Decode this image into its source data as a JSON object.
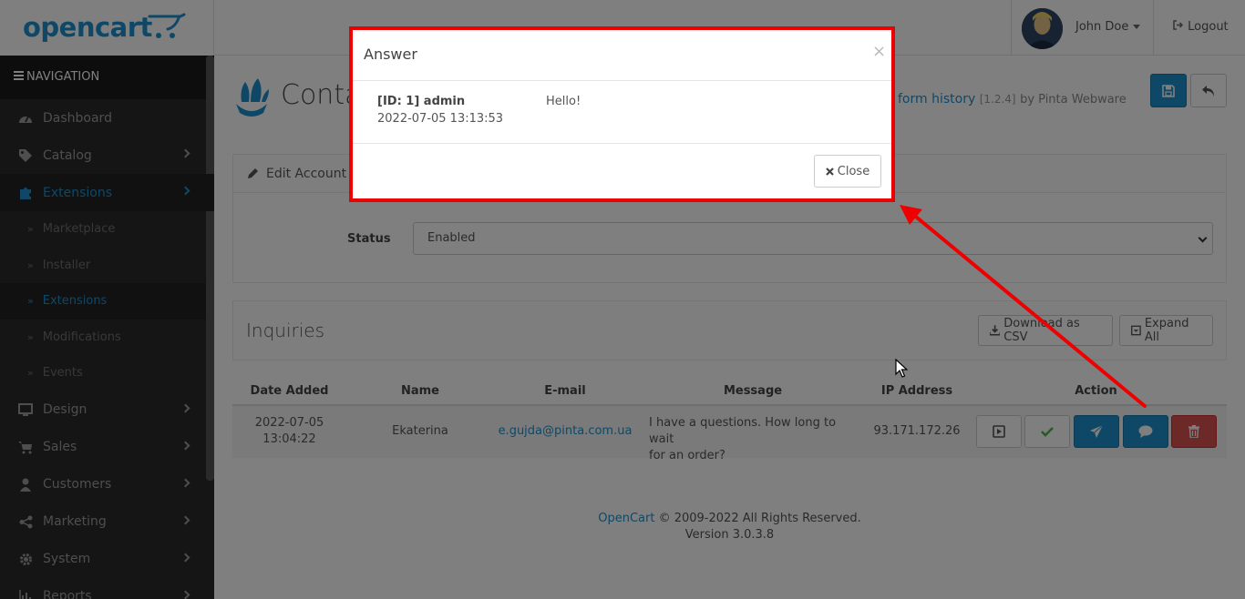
{
  "header": {
    "logo_text": "opencart",
    "user_name": "John Doe",
    "logout_label": "Logout"
  },
  "sidebar": {
    "title": "NAVIGATION",
    "items": [
      {
        "label": "Dashboard",
        "icon": "dashboard-icon"
      },
      {
        "label": "Catalog",
        "icon": "tag-icon"
      },
      {
        "label": "Extensions",
        "icon": "puzzle-icon"
      },
      {
        "label": "Design",
        "icon": "monitor-icon"
      },
      {
        "label": "Sales",
        "icon": "cart-icon"
      },
      {
        "label": "Customers",
        "icon": "user-icon"
      },
      {
        "label": "Marketing",
        "icon": "share-icon"
      },
      {
        "label": "System",
        "icon": "gear-icon"
      },
      {
        "label": "Reports",
        "icon": "bar-chart-icon"
      }
    ],
    "sub_items": [
      "Marketplace",
      "Installer",
      "Extensions",
      "Modifications",
      "Events"
    ]
  },
  "page": {
    "title": "Conta",
    "breadcrumb_link": "form history",
    "version": "[1.2.4]",
    "by_text": "by Pinta Webware"
  },
  "edit_panel": {
    "heading": "Edit Account",
    "status_label": "Status",
    "status_value": "Enabled"
  },
  "inquiries": {
    "title": "Inquiries",
    "download_label": "Download as CSV",
    "expand_label": "Expand All",
    "columns": [
      "Date Added",
      "Name",
      "E-mail",
      "Message",
      "IP Address",
      "Action"
    ],
    "rows": [
      {
        "date": "2022-07-05",
        "time": "13:04:22",
        "name": "Ekaterina",
        "email": "e.gujda@pinta.com.ua",
        "message_line1": "I have a questions. How long to wait",
        "message_line2": "for an order?",
        "ip": "93.171.172.26"
      }
    ]
  },
  "footer": {
    "link": "OpenCart",
    "copyright": "© 2009-2022 All Rights Reserved.",
    "version": "Version 3.0.3.8"
  },
  "modal": {
    "title": "Answer",
    "close_x": "×",
    "author": "[ID: 1] admin",
    "datetime": "2022-07-05 13:13:53",
    "message": "Hello!",
    "close_label": "Close"
  },
  "colors": {
    "primary": "#1e91cf",
    "sidebar_bg": "#2b2b2b",
    "success": "#4cb64c",
    "danger": "#d9534f",
    "annotation": "#ee0000"
  }
}
